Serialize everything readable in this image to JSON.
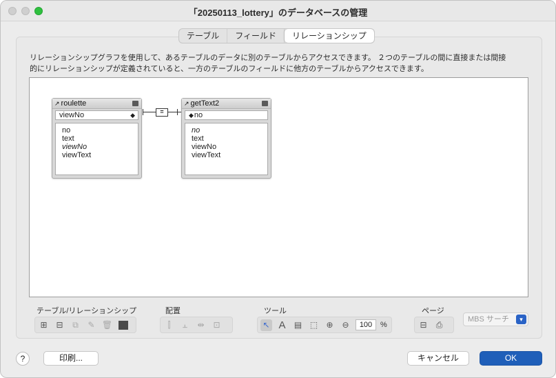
{
  "window": {
    "title": "「20250113_lottery」のデータベースの管理"
  },
  "tabs": [
    {
      "label": "テーブル",
      "active": false
    },
    {
      "label": "フィールド",
      "active": false
    },
    {
      "label": "リレーションシップ",
      "active": true
    }
  ],
  "description": {
    "line1": "リレーションシップグラフを使用して、あるテーブルのデータに別のテーブルからアクセスできます。 ２つのテーブルの間に直接または間接",
    "line2": "的にリレーションシップが定義されていると、一方のテーブルのフィールドに他方のテーブルからアクセスできます。"
  },
  "graph": {
    "table_left": {
      "name": "roulette",
      "key_field": "viewNo",
      "fields": [
        {
          "name": "no",
          "italic": false
        },
        {
          "name": "text",
          "italic": false
        },
        {
          "name": "viewNo",
          "italic": true
        },
        {
          "name": "viewText",
          "italic": false
        }
      ]
    },
    "table_right": {
      "name": "getText2",
      "key_field": "no",
      "fields": [
        {
          "name": "no",
          "italic": true
        },
        {
          "name": "text",
          "italic": false
        },
        {
          "name": "viewNo",
          "italic": false
        },
        {
          "name": "viewText",
          "italic": false
        }
      ]
    },
    "relationship_operator": "="
  },
  "toolbar": {
    "group_table_label": "テーブル/リレーションシップ",
    "group_arrange_label": "配置",
    "group_tools_label": "ツール",
    "group_page_label": "ページ",
    "zoom_value": "100",
    "zoom_unit": "%"
  },
  "search": {
    "label": "MBS サーチ"
  },
  "buttons": {
    "help": "?",
    "print": "印刷...",
    "cancel": "キャンセル",
    "ok": "OK"
  },
  "colors": {
    "accent": "#1f5fb9",
    "window_bg": "#ececec",
    "zoom_button": "#2fc03f"
  }
}
